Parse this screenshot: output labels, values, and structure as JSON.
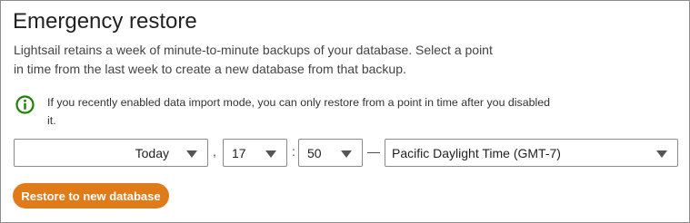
{
  "panel": {
    "title": "Emergency restore",
    "description": "Lightsail retains a week of minute-to-minute backups of your database. Select a point in time from the last week to create a new database from that backup.",
    "info_icon": "info-circle-icon",
    "info_text": "If you recently enabled data import mode, you can only restore from a point in time after you disabled it."
  },
  "restore_point": {
    "date": "Today",
    "comma": ",",
    "hour": "17",
    "colon": ":",
    "minute": "50",
    "dash": "—",
    "timezone": "Pacific Daylight Time (GMT-7)"
  },
  "actions": {
    "restore_label": "Restore to new database"
  },
  "colors": {
    "accent": "#e07b1a",
    "info": "#1d8102"
  }
}
